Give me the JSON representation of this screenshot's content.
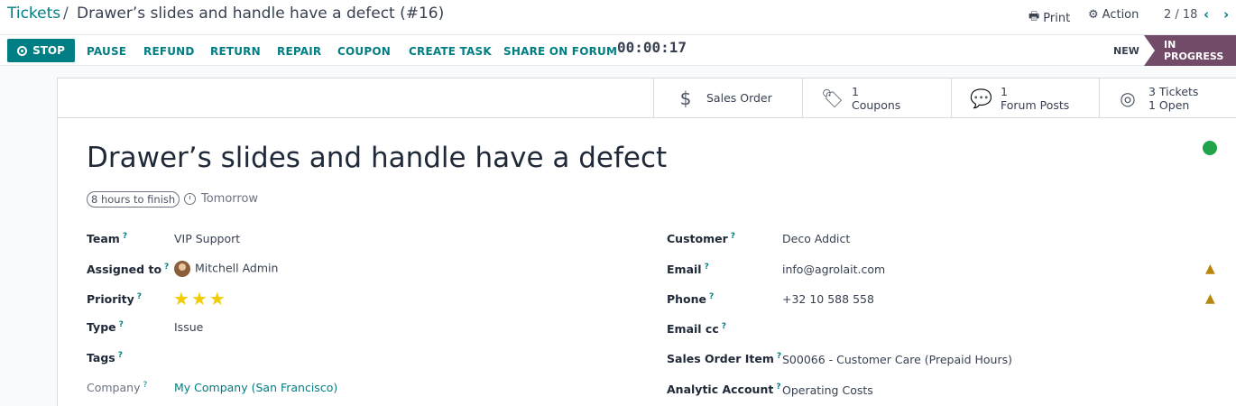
{
  "breadcrumb": {
    "root": "Tickets",
    "separator": "/",
    "current": "Drawer’s slides and handle have a defect (#16)"
  },
  "toolbar": {
    "print": "Print",
    "action": "Action",
    "pager": "2 / 18"
  },
  "actions": {
    "stop": "STOP",
    "buttons": [
      "PAUSE",
      "REFUND",
      "RETURN",
      "REPAIR",
      "COUPON",
      "CREATE TASK",
      "SHARE ON FORUM"
    ],
    "timer": "00:00:17"
  },
  "stages": {
    "new": "NEW",
    "in_progress": "IN PROGRESS",
    "active": "IN PROGRESS"
  },
  "smart_buttons": {
    "sales_order": {
      "label": "Sales Order"
    },
    "coupons": {
      "count": "1",
      "label": "Coupons"
    },
    "forum_posts": {
      "count": "1",
      "label": "Forum Posts"
    },
    "tickets": {
      "line1": "3 Tickets",
      "line2": "1 Open"
    }
  },
  "ticket": {
    "title": "Drawer’s slides and handle have a defect",
    "deadline": "8 hours to finish",
    "due": "Tomorrow",
    "status_color": "#21a34a"
  },
  "fields_left": {
    "team": {
      "label": "Team",
      "value": "VIP Support"
    },
    "assigned_to": {
      "label": "Assigned to",
      "value": "Mitchell Admin"
    },
    "priority": {
      "label": "Priority",
      "value": 3,
      "max": 3
    },
    "type": {
      "label": "Type",
      "value": "Issue"
    },
    "tags": {
      "label": "Tags",
      "value": ""
    },
    "company": {
      "label": "Company",
      "value": "My Company (San Francisco)"
    }
  },
  "fields_right": {
    "customer": {
      "label": "Customer",
      "value": "Deco Addict"
    },
    "email": {
      "label": "Email",
      "value": "info@agrolait.com"
    },
    "phone": {
      "label": "Phone",
      "value": "+32 10 588 558"
    },
    "email_cc": {
      "label": "Email cc",
      "value": ""
    },
    "sales_order_item": {
      "label": "Sales Order Item",
      "value": "S00066 - Customer Care (Prepaid Hours)"
    },
    "analytic_account": {
      "label": "Analytic Account",
      "value": "Operating Costs"
    }
  },
  "help_marker": "?",
  "colors": {
    "accent": "#017e84",
    "stage": "#714b67",
    "stars": "#f3cc00",
    "warning": "#b8860b"
  }
}
